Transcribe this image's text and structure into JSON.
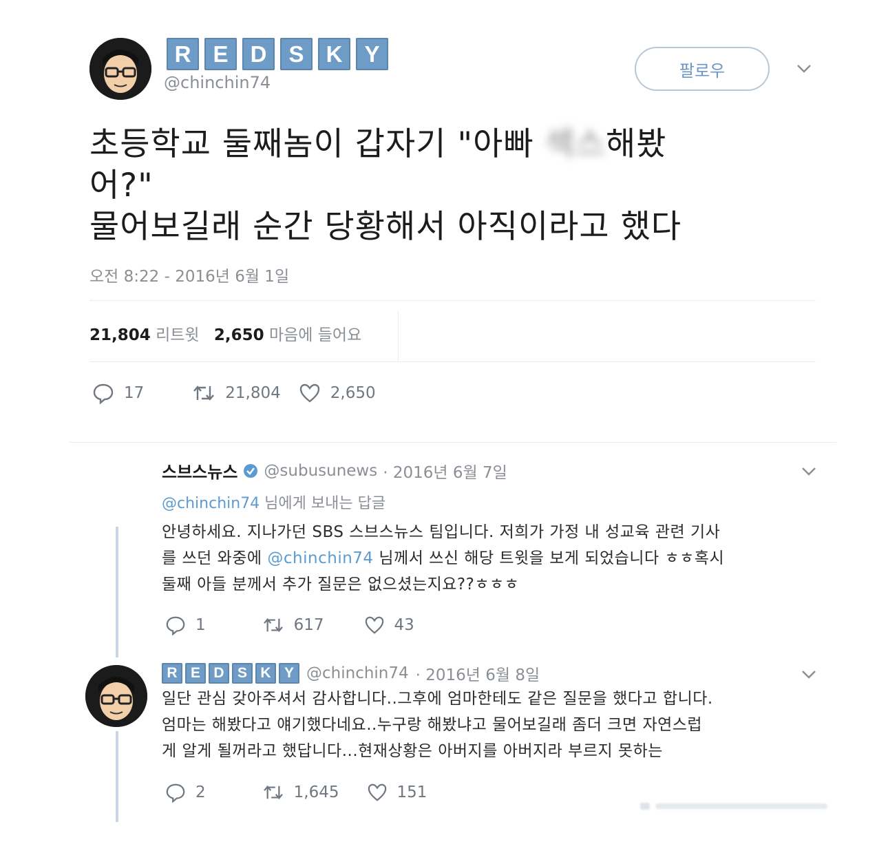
{
  "main_tweet": {
    "display_name_tiles": [
      "R",
      "E",
      "D",
      "S",
      "K",
      "Y"
    ],
    "handle": "@chinchin74",
    "follow_label": "팔로우",
    "text_line1_prefix": "초등학교 둘째놈이 갑자기 \"아빠 ",
    "text_line1_blurred": "섹스",
    "text_line1_suffix": "해봤",
    "text_line2": "어?\"",
    "text_line3": "물어보길래 순간 당황해서 아직이라고 했다",
    "timestamp": "오전 8:22 - 2016년 6월 1일",
    "retweet_count": "21,804",
    "retweet_label": "리트윗",
    "like_count": "2,650",
    "like_label": "마음에 들어요",
    "actions": {
      "reply": "17",
      "retweet": "21,804",
      "like": "2,650"
    }
  },
  "reply1": {
    "name": "스브스뉴스",
    "verified": true,
    "handle": "@subusunews",
    "date": "· 2016년 6월 7일",
    "reply_to_handle": "@chinchin74",
    "reply_to_suffix": " 님에게 보내는 답글",
    "line1": "안녕하세요. 지나가던 SBS 스브스뉴스 팀입니다. 저희가 가정 내 성교육 관련 기사",
    "line2_prefix": "를 쓰던 와중에 ",
    "line2_mention": "@chinchin74",
    "line2_suffix": " 님께서 쓰신 해당 트윗을 보게 되었습니다 ㅎㅎ혹시",
    "line3": "둘째 아들 분께서 추가 질문은 없으셨는지요??ㅎㅎㅎ",
    "actions": {
      "reply": "1",
      "retweet": "617",
      "like": "43"
    }
  },
  "reply2": {
    "name_tiles": [
      "R",
      "E",
      "D",
      "S",
      "K",
      "Y"
    ],
    "handle": "@chinchin74",
    "date": "· 2016년 6월 8일",
    "line1": "일단 관심 갖아주셔서 감사합니다..그후에 엄마한테도 같은 질문을 했다고 합니다.",
    "line2": "엄마는 해봤다고 얘기했다네요..누구랑 해봤냐고 물어보길래 좀더 크면 자연스럽",
    "line3": "게 알게 될꺼라고 했답니다...현재상황은 아버지를 아버지라 부르지 못하는",
    "actions": {
      "reply": "2",
      "retweet": "1,645",
      "like": "151"
    }
  },
  "colors": {
    "accent": "#5b9bd1",
    "tile": "#6f9cc6",
    "muted": "#8a8f95"
  },
  "icons": [
    "reply-icon",
    "retweet-icon",
    "heart-icon",
    "chevron-down-icon",
    "verified-icon"
  ]
}
